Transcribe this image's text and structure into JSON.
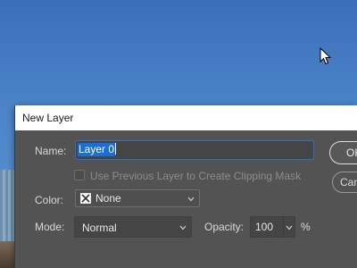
{
  "dialog": {
    "title": "New Layer",
    "name": {
      "label": "Name:",
      "value": "Layer 0"
    },
    "clipping_mask": {
      "label": "Use Previous Layer to Create Clipping Mask",
      "checked": false,
      "enabled": false
    },
    "color": {
      "label": "Color:",
      "value": "None"
    },
    "mode": {
      "label": "Mode:",
      "value": "Normal"
    },
    "opacity": {
      "label": "Opacity:",
      "value": "100",
      "unit": "%"
    },
    "buttons": {
      "ok_label": "OK",
      "cancel_label": "Cancel"
    }
  },
  "icons": {
    "color_swatch": "none-swatch-icon",
    "dropdown": "chevron-down-icon",
    "cursor": "mouse-pointer-icon"
  },
  "colors": {
    "dialog_bg": "#535353",
    "selection": "#1a6fd6",
    "focus_border": "#2d6ec9"
  }
}
